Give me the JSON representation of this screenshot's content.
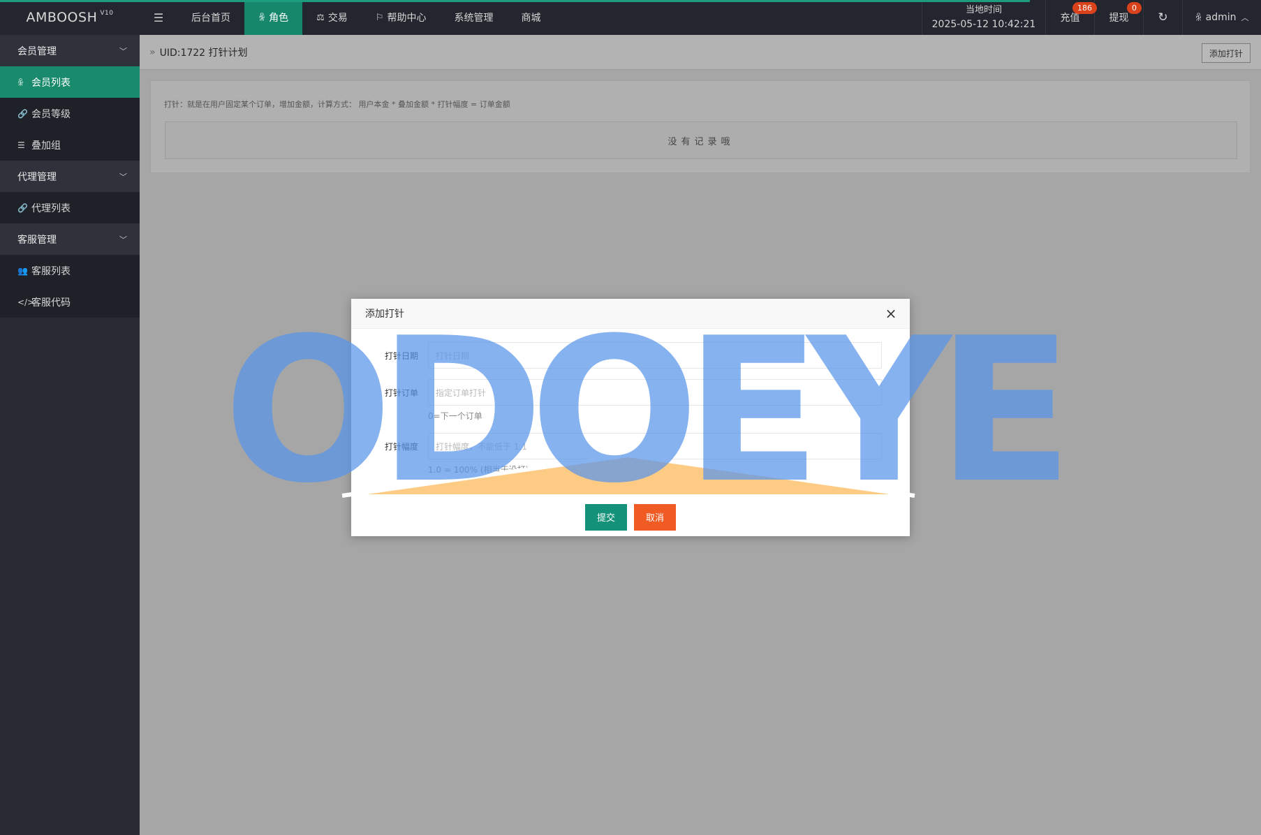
{
  "app": {
    "logo": "AMBOOSH",
    "version": "V10"
  },
  "topnav": {
    "toggle_icon": "☰",
    "items": [
      {
        "label": "后台首页",
        "icon": ""
      },
      {
        "label": "角色",
        "icon": "ꆜ"
      },
      {
        "label": "交易",
        "icon": "⚖"
      },
      {
        "label": "帮助中心",
        "icon": "⚐"
      },
      {
        "label": "系统管理",
        "icon": ""
      },
      {
        "label": "商城",
        "icon": ""
      }
    ],
    "active_index": 1
  },
  "header": {
    "clock_label": "当地时间",
    "clock_value": "2025-05-12 10:42:21",
    "recharge_label": "充值",
    "recharge_count": "186",
    "withdraw_label": "提现",
    "withdraw_count": "0",
    "refresh_icon": "↻",
    "user_icon": "ꆜ",
    "user_name": "admin",
    "caret": "︿"
  },
  "sidebar": {
    "groups": [
      {
        "label": "会员管理",
        "chevron": "﹀",
        "items": [
          {
            "label": "会员列表",
            "icon": "ꆜ",
            "active": true
          },
          {
            "label": "会员等级",
            "icon": "🔗",
            "active": false
          },
          {
            "label": "叠加组",
            "icon": "☰",
            "active": false
          }
        ]
      },
      {
        "label": "代理管理",
        "chevron": "﹀",
        "items": [
          {
            "label": "代理列表",
            "icon": "🔗",
            "active": false
          }
        ]
      },
      {
        "label": "客服管理",
        "chevron": "﹀",
        "items": [
          {
            "label": "客服列表",
            "icon": "👥",
            "active": false
          },
          {
            "label": "客服代码",
            "icon": "</>",
            "active": false
          }
        ]
      }
    ]
  },
  "breadcrumb": {
    "separator": "»",
    "title": "UID:1722 打针计划",
    "add_button": "添加打针"
  },
  "card": {
    "note": "打针：就是在用户固定某个订单，增加金额，计算方式： 用户本金 * 叠加金额 * 打针幅度 = 订单金额",
    "empty_text": "没有记录哦"
  },
  "modal": {
    "title": "添加打针",
    "close_icon": "×",
    "fields": [
      {
        "label": "打针日期",
        "placeholder": "打针日期",
        "hint": ""
      },
      {
        "label": "打针订单",
        "placeholder": "指定订单打针",
        "hint": "0=下一个订单"
      },
      {
        "label": "打针幅度",
        "placeholder": "打针幅度，不能低于 1.1",
        "hint": "1.0 = 100% (相当于没打)"
      }
    ],
    "submit": "提交",
    "cancel": "取消"
  },
  "watermark": {
    "text": "ODOEYE"
  },
  "colors": {
    "header_bg": "#23262e",
    "sidebar_bg": "#272a33",
    "accent": "#1a8a6c",
    "submit": "#149279",
    "cancel": "#f05a23",
    "badge": "#d9421b",
    "watermark_blue": "#5894ea",
    "watermark_orange": "#fdc779"
  }
}
